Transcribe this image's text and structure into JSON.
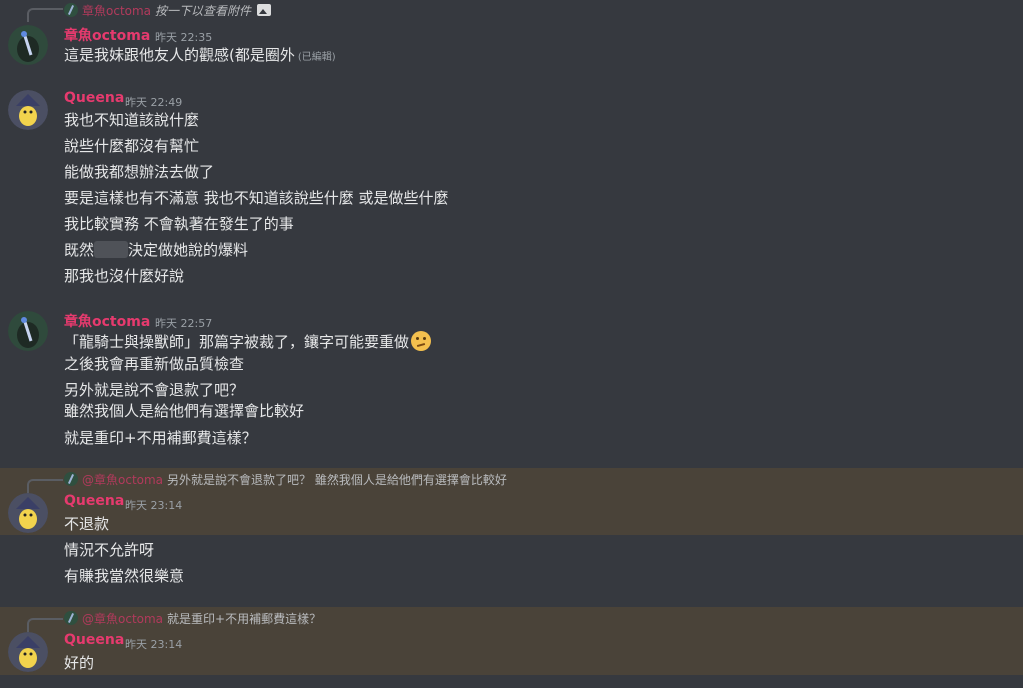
{
  "users": {
    "octoma": {
      "name": "章魚octoma",
      "mention": "@章魚octoma"
    },
    "queena": {
      "name": "Queena"
    }
  },
  "top_reply": {
    "author": "章魚octoma",
    "text": "按一下以查看附件"
  },
  "messages": [
    {
      "author": "章魚octoma",
      "time": "昨天 22:35",
      "lines": [
        "這是我妹跟他友人的觀感(都是圈外"
      ],
      "edited": "(已編輯)"
    },
    {
      "author": "Queena",
      "time": "昨天 22:49",
      "lines": [
        "我也不知道該說什麼",
        "說些什麼都沒有幫忙",
        "能做我都想辦法去做了",
        "要是這樣也有不滿意 我也不知道該說些什麼 或是做些什麼",
        "我比較實務 不會執著在發生了的事",
        "既然",
        "決定做她說的爆料",
        "那我也沒什麼好說"
      ]
    },
    {
      "author": "章魚octoma",
      "time": "昨天 22:57",
      "lines": [
        "「龍騎士與操獸師」那篇字被裁了，鑲字可能要重做",
        "之後我會再重新做品質檢查",
        "另外就是說不會退款了吧？",
        "雖然我個人是給他們有選擇會比較好",
        "就是重印+不用補郵費這樣？"
      ]
    },
    {
      "reply_to": {
        "author": "@章魚octoma",
        "text": "另外就是說不會退款了吧？ 雖然我個人是給他們有選擇會比較好"
      },
      "author": "Queena",
      "time": "昨天 23:14",
      "lines": [
        "不退款",
        "情況不允許呀",
        "有賺我當然很樂意"
      ]
    },
    {
      "reply_to": {
        "author": "@章魚octoma",
        "text": "就是重印+不用補郵費這樣？"
      },
      "author": "Queena",
      "time": "昨天 23:14",
      "lines": [
        "好的"
      ]
    }
  ]
}
